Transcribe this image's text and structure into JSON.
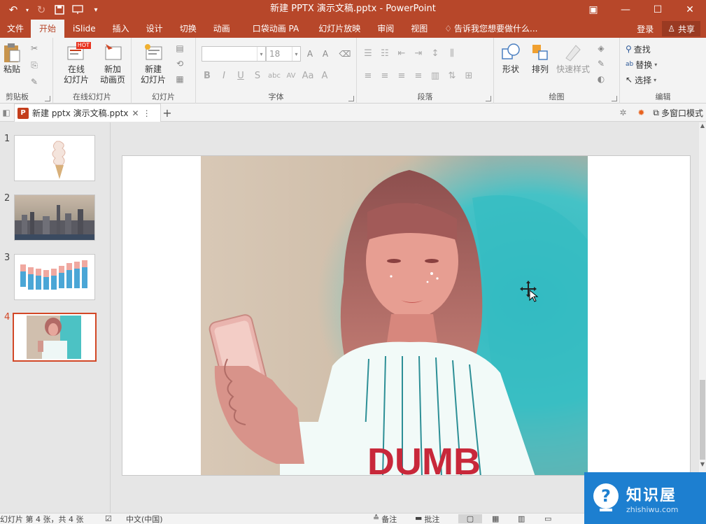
{
  "titlebar": {
    "title": "新建 PPTX 演示文稿.pptx - PowerPoint",
    "qat_icons": [
      "undo-icon",
      "redo-icon",
      "save-icon",
      "present-icon",
      "customize-icon"
    ]
  },
  "tabs": [
    "文件",
    "开始",
    "iSlide",
    "插入",
    "设计",
    "切换",
    "动画",
    "口袋动画 PA",
    "幻灯片放映",
    "审阅",
    "视图"
  ],
  "active_tab": "开始",
  "tell_me": "告诉我您想要做什么...",
  "account": {
    "signin": "登录",
    "share": "共享"
  },
  "ribbon": {
    "clipboard": {
      "label": "剪贴板",
      "paste": "粘贴"
    },
    "online_slides": {
      "label": "在线幻灯片",
      "online": "在线\n幻灯片",
      "new_anim": "新加\n动画页",
      "hot": "HOT"
    },
    "slides": {
      "label": "幻灯片",
      "new_slide": "新建\n幻灯片"
    },
    "font": {
      "label": "字体",
      "size": "18"
    },
    "paragraph": {
      "label": "段落"
    },
    "drawing": {
      "label": "绘图",
      "shapes": "形状",
      "arrange": "排列",
      "quick_styles": "快速样式"
    },
    "editing": {
      "label": "编辑",
      "find": "查找",
      "replace": "替换",
      "select": "选择"
    }
  },
  "doc_tab": {
    "name": "新建 pptx 演示文稿.pptx",
    "multi_window": "多窗口模式"
  },
  "slides": [
    {
      "num": "1",
      "selected": false
    },
    {
      "num": "2",
      "selected": false
    },
    {
      "num": "3",
      "selected": false
    },
    {
      "num": "4",
      "selected": true
    }
  ],
  "slide_text": {
    "shirt": "DUMB"
  },
  "statusbar": {
    "slide_info": "幻灯片 第 4 张，共 4 张",
    "language": "中文(中国)",
    "notes": "备注",
    "comments": "批注"
  },
  "watermark": {
    "title": "知识屋",
    "url": "zhishiwu.com"
  },
  "colors": {
    "accent": "#b7472a",
    "selected": "#d24726",
    "watermark": "#1d7fd0"
  }
}
